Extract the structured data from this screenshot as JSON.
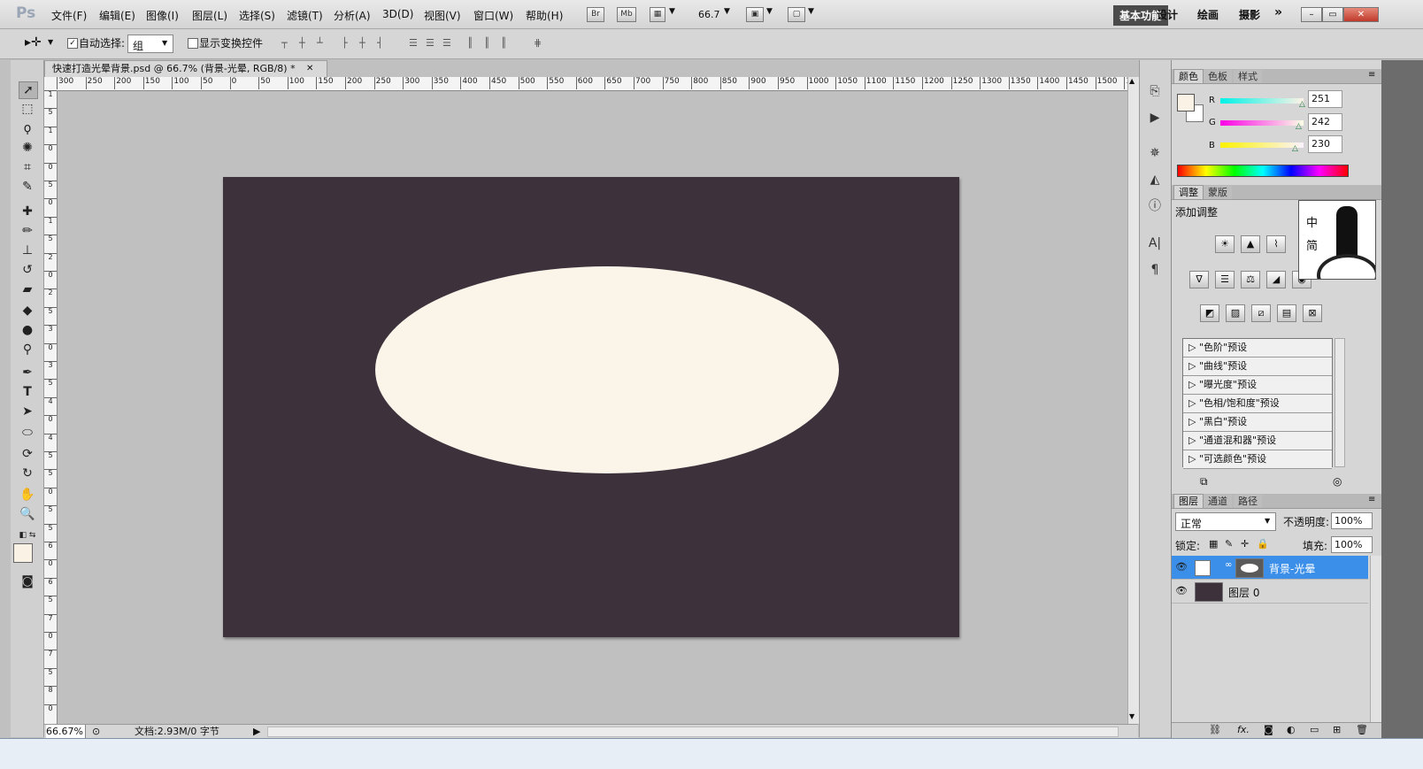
{
  "app": {
    "logo": "Ps"
  },
  "menu": [
    "文件(F)",
    "编辑(E)",
    "图像(I)",
    "图层(L)",
    "选择(S)",
    "滤镜(T)",
    "分析(A)",
    "3D(D)",
    "视图(V)",
    "窗口(W)",
    "帮助(H)"
  ],
  "app_bar": {
    "bridge": "Br",
    "mini_bridge": "Mb",
    "zoom": "66.7"
  },
  "workspaces": {
    "basic": "基本功能",
    "design": "设计",
    "paint": "绘画",
    "photo": "摄影",
    "more": "»"
  },
  "window_controls": {
    "minimize": "–",
    "restore": "▭",
    "close": "✕"
  },
  "options": {
    "auto_select_label": "自动选择:",
    "auto_select_value": "组",
    "show_transform_label": "显示变换控件",
    "auto_select_checked": "✓"
  },
  "document": {
    "tab_title": "快速打造光晕背景.psd @ 66.7% (背景-光晕, RGB/8) *",
    "tab_close": "✕",
    "bg_color": "#3d323c",
    "ellipse_color": "#faf4e9"
  },
  "ruler_h": [
    "300",
    "250",
    "200",
    "150",
    "100",
    "50",
    "0",
    "50",
    "100",
    "150",
    "200",
    "250",
    "300",
    "350",
    "400",
    "450",
    "500",
    "550",
    "600",
    "650",
    "700",
    "750",
    "800",
    "850",
    "900",
    "950",
    "1000",
    "1050",
    "1100",
    "1150",
    "1200",
    "1250",
    "1300",
    "1350",
    "1400",
    "1450",
    "1500",
    "15"
  ],
  "ruler_v": [
    "1",
    "5",
    "1",
    "0",
    "0",
    "5",
    "0",
    "1",
    "5",
    "2",
    "0",
    "2",
    "5",
    "3",
    "0",
    "3",
    "5",
    "4",
    "0",
    "4",
    "5",
    "5",
    "0",
    "5",
    "5",
    "6",
    "0",
    "6",
    "5",
    "7",
    "0",
    "7",
    "5",
    "8",
    "0"
  ],
  "status": {
    "zoom": "66.67%",
    "doc_info": "文档:2.93M/0 字节",
    "arrow": "▶"
  },
  "color_panel": {
    "tabs": [
      "颜色",
      "色板",
      "样式"
    ],
    "labels": {
      "r": "R",
      "g": "G",
      "b": "B"
    },
    "r": "251",
    "g": "242",
    "b": "230",
    "fg_color": "#fbf2e6"
  },
  "adjust_panel": {
    "tabs": [
      "调整",
      "蒙版"
    ],
    "title": "添加调整",
    "presets": [
      "\"色阶\"预设",
      "\"曲线\"预设",
      "\"曝光度\"预设",
      "\"色相/饱和度\"预设",
      "\"黑白\"预设",
      "\"通道混和器\"预设",
      "\"可选颜色\"预设"
    ]
  },
  "layers_panel": {
    "tabs": [
      "图层",
      "通道",
      "路径"
    ],
    "blend_mode": "正常",
    "opacity_label": "不透明度:",
    "opacity": "100%",
    "lock_label": "锁定:",
    "fill_label": "填充:",
    "fill": "100%",
    "layers": [
      {
        "name": "背景-光晕",
        "selected": true
      },
      {
        "name": "图层 0",
        "selected": false
      }
    ],
    "footer_fx": "fx."
  },
  "sticker": {
    "line1": "中",
    "line2": "简"
  }
}
